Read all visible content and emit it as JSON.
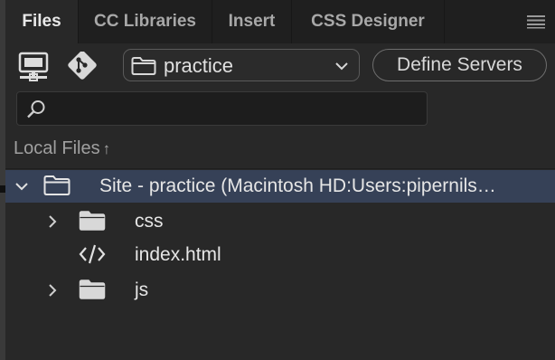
{
  "tabs": [
    {
      "label": "Files",
      "active": true
    },
    {
      "label": "CC Libraries",
      "active": false
    },
    {
      "label": "Insert",
      "active": false
    },
    {
      "label": "CSS Designer",
      "active": false
    }
  ],
  "toolbar": {
    "site_select_value": "practice",
    "define_servers_label": "Define Servers"
  },
  "search": {
    "value": "",
    "placeholder": ""
  },
  "local_files": {
    "label": "Local Files",
    "sort_indicator": "↑"
  },
  "tree": {
    "root": {
      "label": "Site - practice (Macintosh HD:Users:pipernils…",
      "expanded": true,
      "selected": true
    },
    "children": [
      {
        "label": "css",
        "type": "folder",
        "expanded": false
      },
      {
        "label": "index.html",
        "type": "html-file"
      },
      {
        "label": "js",
        "type": "folder",
        "expanded": false
      }
    ]
  },
  "colors": {
    "panel_bg": "#282828",
    "tabbar_bg": "#1f1f1f",
    "selection_bg": "#364157",
    "text": "#e6e6e6"
  }
}
